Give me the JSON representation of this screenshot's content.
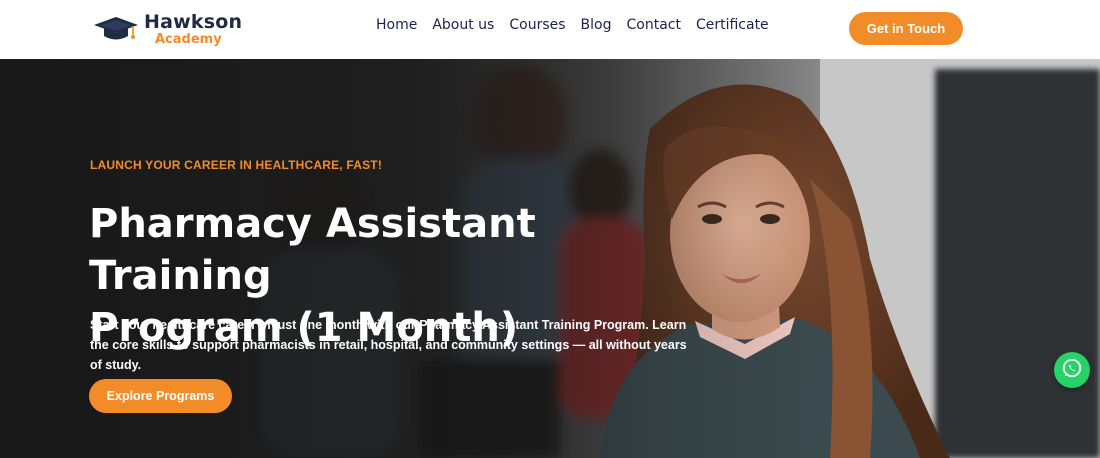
{
  "brand": {
    "name": "Hawkson",
    "sub": "Academy",
    "icon": "graduation-cap-icon",
    "primary_color": "#1f2a44",
    "accent_color": "#f28c28"
  },
  "nav": {
    "items": [
      {
        "label": "Home"
      },
      {
        "label": "About us"
      },
      {
        "label": "Courses"
      },
      {
        "label": "Blog"
      },
      {
        "label": "Contact"
      },
      {
        "label": "Certificate"
      }
    ]
  },
  "header": {
    "cta_label": "Get in Touch"
  },
  "hero": {
    "eyebrow": "LAUNCH YOUR CAREER IN HEALTHCARE, FAST!",
    "title_line1": "Pharmacy Assistant Training",
    "title_line2": "Program (1 Month)",
    "description": "Start your healthcare career in just one month with our Pharmacy Assistant Training Program. Learn the core skills to support pharmacists in retail, hospital, and community settings — all without years of study.",
    "button_label": "Explore Programs"
  },
  "floating": {
    "icon": "whatsapp-icon",
    "color": "#25d366"
  }
}
